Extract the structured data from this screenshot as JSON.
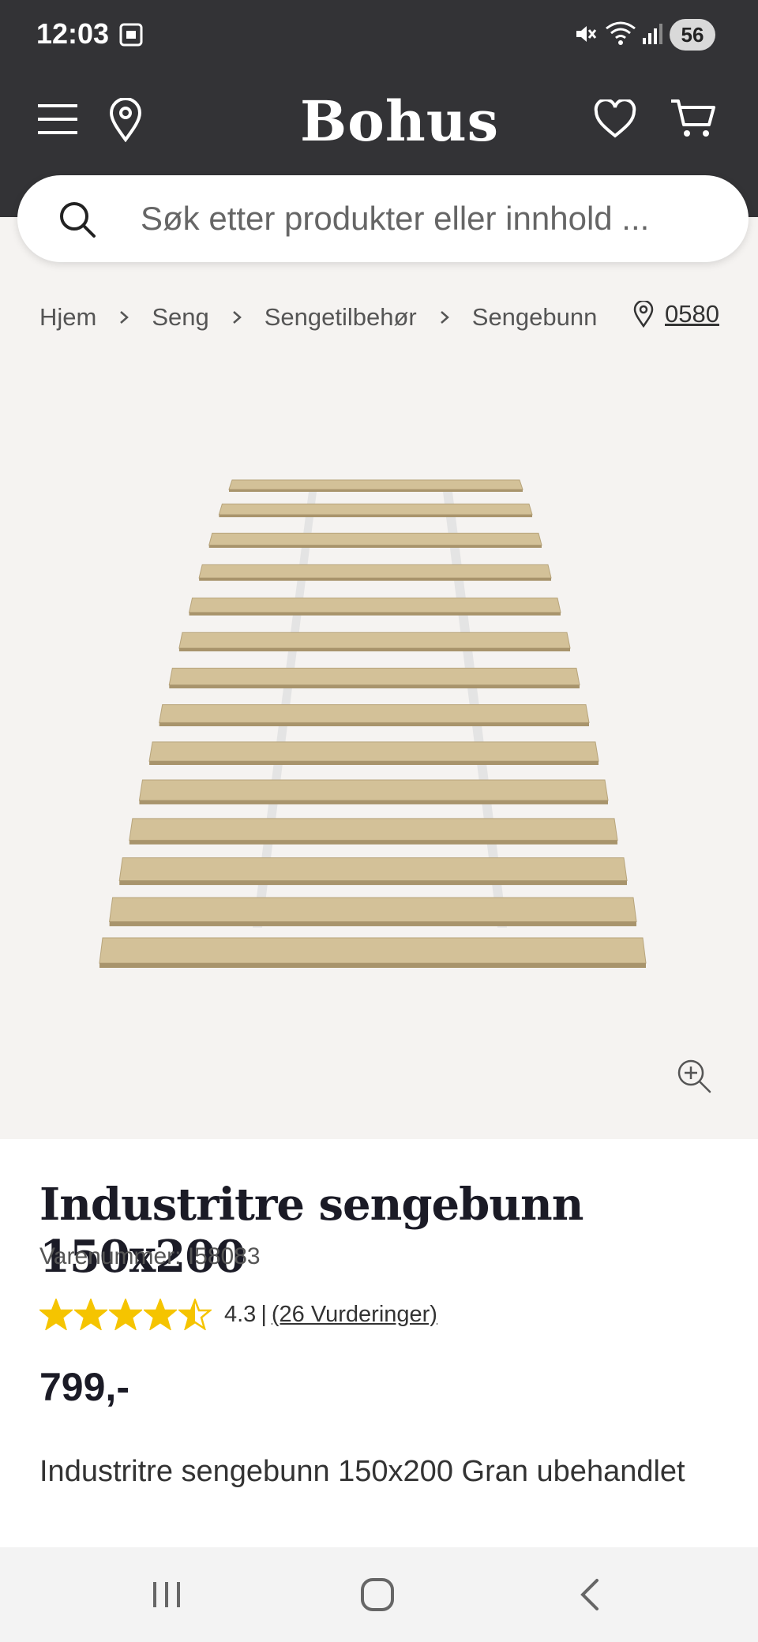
{
  "status_bar": {
    "time": "12:03",
    "battery": "56",
    "icons": [
      "screenshot-icon",
      "mute-icon",
      "wifi-icon",
      "signal-icon"
    ]
  },
  "header": {
    "logo": "Bohus",
    "icons": [
      "menu-icon",
      "location-pin-icon",
      "heart-icon",
      "cart-icon"
    ]
  },
  "search": {
    "placeholder": "Søk etter produkter eller innhold ..."
  },
  "breadcrumb": {
    "items": [
      "Hjem",
      "Seng",
      "Sengetilbehør",
      "Sengebunn"
    ]
  },
  "store": {
    "code": "0580"
  },
  "product": {
    "title": "Industritre sengebunn 150x200",
    "sku": "Varenummer: I58083",
    "rating_value": 4.3,
    "rating_text": "4.3",
    "rating_separator": "|",
    "reviews": "(26 Vurderinger)",
    "price": "799,-",
    "description": "Industritre sengebunn 150x200 Gran ubehandlet"
  },
  "colors": {
    "header_bg": "#333336",
    "page_bg": "#f5f3f1",
    "star": "#f5c400",
    "wood": "#d3c198"
  },
  "system_nav": {
    "icons": [
      "recent-apps-icon",
      "home-icon",
      "back-icon"
    ]
  }
}
